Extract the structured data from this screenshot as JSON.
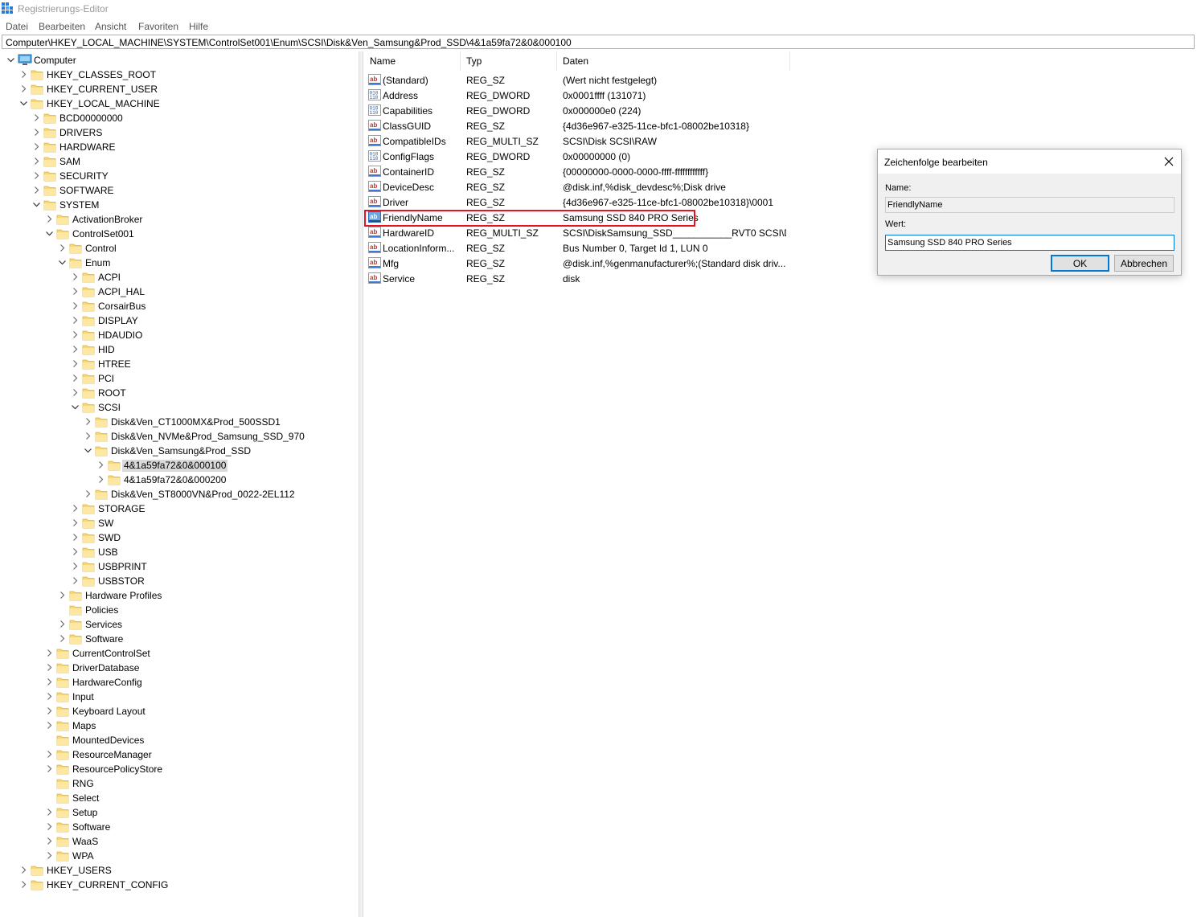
{
  "window": {
    "title": "Registrierungs-Editor"
  },
  "menu": [
    "Datei",
    "Bearbeiten",
    "Ansicht",
    "Favoriten",
    "Hilfe"
  ],
  "address": "Computer\\HKEY_LOCAL_MACHINE\\SYSTEM\\ControlSet001\\Enum\\SCSI\\Disk&Ven_Samsung&Prod_SSD\\4&1a59fa72&0&000100",
  "tree": [
    {
      "label": "Computer",
      "depth": 0,
      "exp": "open",
      "icon": "computer"
    },
    {
      "label": "HKEY_CLASSES_ROOT",
      "depth": 1,
      "exp": "closed"
    },
    {
      "label": "HKEY_CURRENT_USER",
      "depth": 1,
      "exp": "closed"
    },
    {
      "label": "HKEY_LOCAL_MACHINE",
      "depth": 1,
      "exp": "open"
    },
    {
      "label": "BCD00000000",
      "depth": 2,
      "exp": "closed"
    },
    {
      "label": "DRIVERS",
      "depth": 2,
      "exp": "closed"
    },
    {
      "label": "HARDWARE",
      "depth": 2,
      "exp": "closed"
    },
    {
      "label": "SAM",
      "depth": 2,
      "exp": "closed"
    },
    {
      "label": "SECURITY",
      "depth": 2,
      "exp": "closed"
    },
    {
      "label": "SOFTWARE",
      "depth": 2,
      "exp": "closed"
    },
    {
      "label": "SYSTEM",
      "depth": 2,
      "exp": "open"
    },
    {
      "label": "ActivationBroker",
      "depth": 3,
      "exp": "closed"
    },
    {
      "label": "ControlSet001",
      "depth": 3,
      "exp": "open"
    },
    {
      "label": "Control",
      "depth": 4,
      "exp": "closed"
    },
    {
      "label": "Enum",
      "depth": 4,
      "exp": "open"
    },
    {
      "label": "ACPI",
      "depth": 5,
      "exp": "closed"
    },
    {
      "label": "ACPI_HAL",
      "depth": 5,
      "exp": "closed"
    },
    {
      "label": "CorsairBus",
      "depth": 5,
      "exp": "closed"
    },
    {
      "label": "DISPLAY",
      "depth": 5,
      "exp": "closed"
    },
    {
      "label": "HDAUDIO",
      "depth": 5,
      "exp": "closed"
    },
    {
      "label": "HID",
      "depth": 5,
      "exp": "closed"
    },
    {
      "label": "HTREE",
      "depth": 5,
      "exp": "closed"
    },
    {
      "label": "PCI",
      "depth": 5,
      "exp": "closed"
    },
    {
      "label": "ROOT",
      "depth": 5,
      "exp": "closed"
    },
    {
      "label": "SCSI",
      "depth": 5,
      "exp": "open"
    },
    {
      "label": "Disk&Ven_CT1000MX&Prod_500SSD1",
      "depth": 6,
      "exp": "closed"
    },
    {
      "label": "Disk&Ven_NVMe&Prod_Samsung_SSD_970",
      "depth": 6,
      "exp": "closed"
    },
    {
      "label": "Disk&Ven_Samsung&Prod_SSD",
      "depth": 6,
      "exp": "open"
    },
    {
      "label": "4&1a59fa72&0&000100",
      "depth": 7,
      "exp": "closed",
      "selected": true
    },
    {
      "label": "4&1a59fa72&0&000200",
      "depth": 7,
      "exp": "closed"
    },
    {
      "label": "Disk&Ven_ST8000VN&Prod_0022-2EL112",
      "depth": 6,
      "exp": "closed"
    },
    {
      "label": "STORAGE",
      "depth": 5,
      "exp": "closed"
    },
    {
      "label": "SW",
      "depth": 5,
      "exp": "closed"
    },
    {
      "label": "SWD",
      "depth": 5,
      "exp": "closed"
    },
    {
      "label": "USB",
      "depth": 5,
      "exp": "closed"
    },
    {
      "label": "USBPRINT",
      "depth": 5,
      "exp": "closed"
    },
    {
      "label": "USBSTOR",
      "depth": 5,
      "exp": "closed"
    },
    {
      "label": "Hardware Profiles",
      "depth": 4,
      "exp": "closed"
    },
    {
      "label": "Policies",
      "depth": 4,
      "exp": "none"
    },
    {
      "label": "Services",
      "depth": 4,
      "exp": "closed"
    },
    {
      "label": "Software",
      "depth": 4,
      "exp": "closed"
    },
    {
      "label": "CurrentControlSet",
      "depth": 3,
      "exp": "closed"
    },
    {
      "label": "DriverDatabase",
      "depth": 3,
      "exp": "closed"
    },
    {
      "label": "HardwareConfig",
      "depth": 3,
      "exp": "closed"
    },
    {
      "label": "Input",
      "depth": 3,
      "exp": "closed"
    },
    {
      "label": "Keyboard Layout",
      "depth": 3,
      "exp": "closed"
    },
    {
      "label": "Maps",
      "depth": 3,
      "exp": "closed"
    },
    {
      "label": "MountedDevices",
      "depth": 3,
      "exp": "none"
    },
    {
      "label": "ResourceManager",
      "depth": 3,
      "exp": "closed"
    },
    {
      "label": "ResourcePolicyStore",
      "depth": 3,
      "exp": "closed"
    },
    {
      "label": "RNG",
      "depth": 3,
      "exp": "none"
    },
    {
      "label": "Select",
      "depth": 3,
      "exp": "none"
    },
    {
      "label": "Setup",
      "depth": 3,
      "exp": "closed"
    },
    {
      "label": "Software",
      "depth": 3,
      "exp": "closed"
    },
    {
      "label": "WaaS",
      "depth": 3,
      "exp": "closed"
    },
    {
      "label": "WPA",
      "depth": 3,
      "exp": "closed"
    },
    {
      "label": "HKEY_USERS",
      "depth": 1,
      "exp": "closed"
    },
    {
      "label": "HKEY_CURRENT_CONFIG",
      "depth": 1,
      "exp": "closed"
    }
  ],
  "columns": {
    "name": "Name",
    "type": "Typ",
    "data": "Daten"
  },
  "values": [
    {
      "name": "(Standard)",
      "type": "REG_SZ",
      "data": "(Wert nicht festgelegt)",
      "icon": "string"
    },
    {
      "name": "Address",
      "type": "REG_DWORD",
      "data": "0x0001ffff (131071)",
      "icon": "binary"
    },
    {
      "name": "Capabilities",
      "type": "REG_DWORD",
      "data": "0x000000e0 (224)",
      "icon": "binary"
    },
    {
      "name": "ClassGUID",
      "type": "REG_SZ",
      "data": "{4d36e967-e325-11ce-bfc1-08002be10318}",
      "icon": "string"
    },
    {
      "name": "CompatibleIDs",
      "type": "REG_MULTI_SZ",
      "data": "SCSI\\Disk SCSI\\RAW",
      "icon": "string"
    },
    {
      "name": "ConfigFlags",
      "type": "REG_DWORD",
      "data": "0x00000000 (0)",
      "icon": "binary"
    },
    {
      "name": "ContainerID",
      "type": "REG_SZ",
      "data": "{00000000-0000-0000-ffff-ffffffffffff}",
      "icon": "string"
    },
    {
      "name": "DeviceDesc",
      "type": "REG_SZ",
      "data": "@disk.inf,%disk_devdesc%;Disk drive",
      "icon": "string"
    },
    {
      "name": "Driver",
      "type": "REG_SZ",
      "data": "{4d36e967-e325-11ce-bfc1-08002be10318}\\0001",
      "icon": "string"
    },
    {
      "name": "FriendlyName",
      "type": "REG_SZ",
      "data": "Samsung SSD 840 PRO Series",
      "icon": "string",
      "selected": true
    },
    {
      "name": "HardwareID",
      "type": "REG_MULTI_SZ",
      "data": "SCSI\\DiskSamsung_SSD___________RVT0 SCSI\\Dis...",
      "icon": "string"
    },
    {
      "name": "LocationInform...",
      "type": "REG_SZ",
      "data": "Bus Number 0, Target Id 1, LUN 0",
      "icon": "string"
    },
    {
      "name": "Mfg",
      "type": "REG_SZ",
      "data": "@disk.inf,%genmanufacturer%;(Standard disk driv...",
      "icon": "string"
    },
    {
      "name": "Service",
      "type": "REG_SZ",
      "data": "disk",
      "icon": "string"
    }
  ],
  "dialog": {
    "title": "Zeichenfolge bearbeiten",
    "name_label": "Name:",
    "name_value": "FriendlyName",
    "value_label": "Wert:",
    "value_value": "Samsung SSD 840 PRO Series",
    "ok_label": "OK",
    "cancel_label": "Abbrechen"
  },
  "colors": {
    "highlight_border": "#e81123",
    "folder": "#f8d775",
    "selection": "#d9d9d9",
    "focus_blue": "#0078d7"
  }
}
